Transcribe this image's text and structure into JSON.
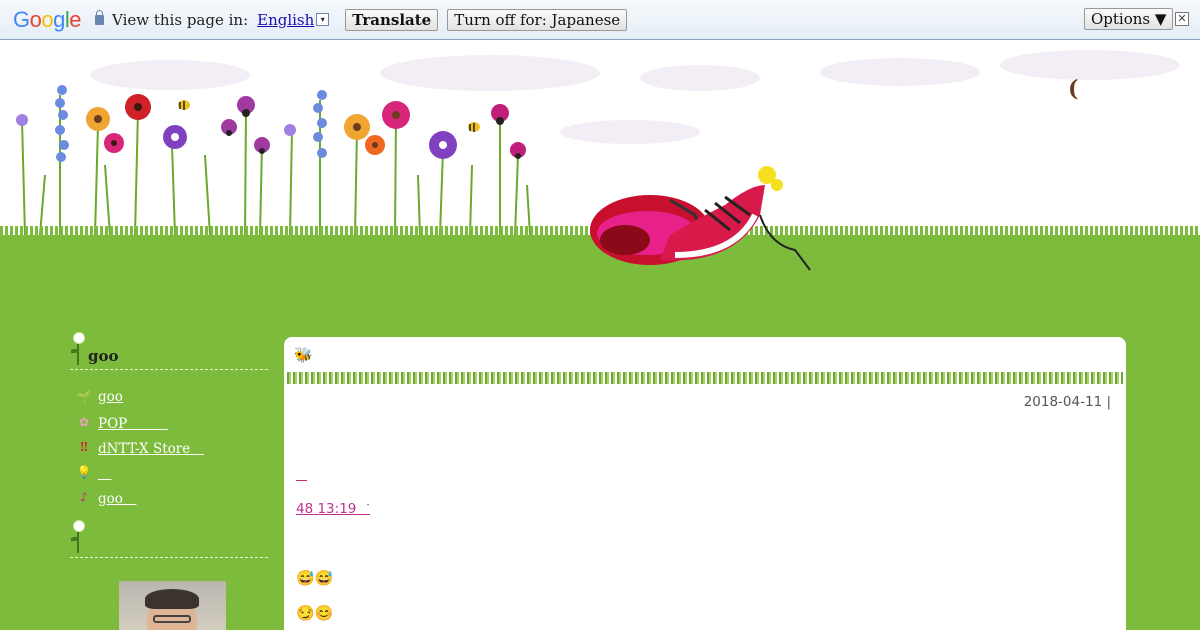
{
  "translate_bar": {
    "logo": [
      "G",
      "o",
      "o",
      "g",
      "l",
      "e"
    ],
    "view_label": "View this page in:",
    "language": "English",
    "dropdown_glyph": "▾",
    "translate_button": "Translate",
    "turn_off_button": "Turn off for: Japanese",
    "options_button": "Options ▼",
    "close_glyph": "✕"
  },
  "header": {
    "paren": "("
  },
  "sidebar": {
    "title1": "goo",
    "links": [
      {
        "icon": "sprout-icon",
        "glyph": "🌱",
        "label": "goo"
      },
      {
        "icon": "flower-icon",
        "glyph": "✿",
        "label": "POP　　　"
      },
      {
        "icon": "double-exclamation-icon",
        "glyph": "‼",
        "label": "dNTT-X Store　"
      },
      {
        "icon": "bulb-icon",
        "glyph": "💡",
        "label": "　"
      },
      {
        "icon": "music-note-icon",
        "glyph": "♪",
        "label": "goo　"
      }
    ],
    "title2": ""
  },
  "post": {
    "bee_icon": "🐝",
    "date": "2018-04-11 |",
    "underline_text": "　",
    "comment_link": "48 13:19　",
    "separator": "·",
    "emoji_line1": "😅😅",
    "emoji_line2": "😏😊"
  },
  "colors": {
    "grass": "#7dbb3c",
    "link_pink": "#c03090",
    "translate_link": "#1a0dab"
  }
}
